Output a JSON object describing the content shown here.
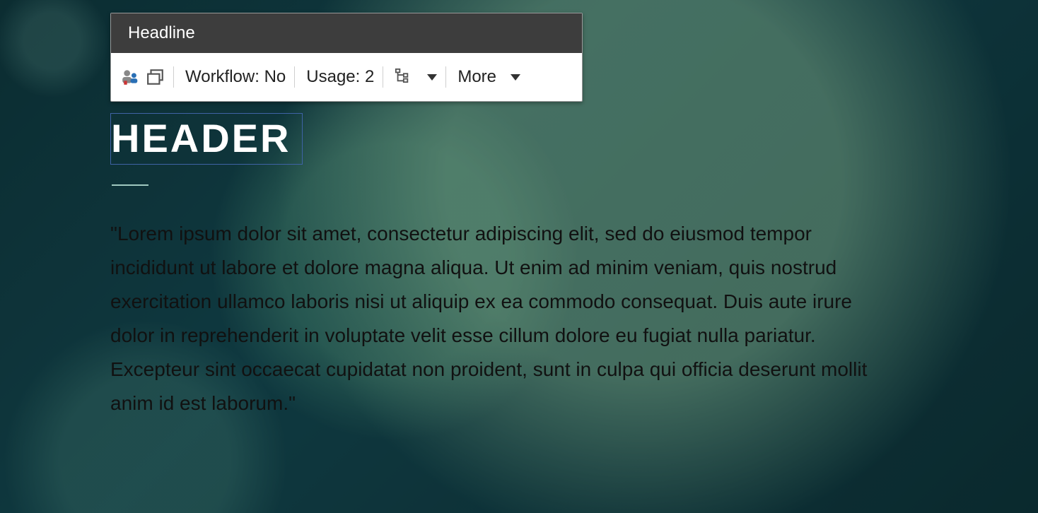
{
  "toolbar": {
    "title": "Headline",
    "workflow_label": "Workflow: No",
    "usage_label": "Usage: 2",
    "more_label": "More"
  },
  "page": {
    "header": "HEADER",
    "body": "\"Lorem ipsum dolor sit amet, consectetur adipiscing elit, sed do eiusmod tempor incididunt ut labore et dolore magna aliqua. Ut enim ad minim veniam, quis nostrud exercitation ullamco laboris nisi ut aliquip ex ea commodo consequat. Duis aute irure dolor in reprehenderit in voluptate velit esse cillum dolore eu fugiat nulla pariatur. Excepteur sint occaecat cupidatat non proident, sunt in culpa qui officia deserunt mollit anim id est laborum.\""
  }
}
